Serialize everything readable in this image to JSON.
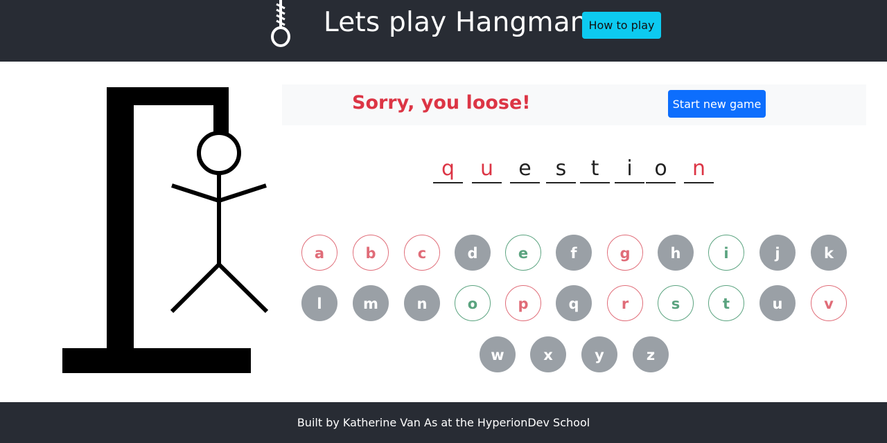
{
  "header": {
    "title": "Lets play Hangman",
    "how_to_play": "How to play"
  },
  "status": {
    "message": "Sorry, you loose!",
    "new_game": "Start new game"
  },
  "word": [
    {
      "letter": "q",
      "state": "missed"
    },
    {
      "letter": "u",
      "state": "missed"
    },
    {
      "letter": "e",
      "state": "found"
    },
    {
      "letter": "s",
      "state": "found"
    },
    {
      "letter": "t",
      "state": "found"
    },
    {
      "letter": "i",
      "state": "found"
    },
    {
      "letter": "o",
      "state": "found"
    },
    {
      "letter": "n",
      "state": "missed"
    }
  ],
  "keyboard": [
    {
      "letter": "a",
      "state": "wrong"
    },
    {
      "letter": "b",
      "state": "wrong"
    },
    {
      "letter": "c",
      "state": "wrong"
    },
    {
      "letter": "d",
      "state": "unused"
    },
    {
      "letter": "e",
      "state": "right"
    },
    {
      "letter": "f",
      "state": "unused"
    },
    {
      "letter": "g",
      "state": "wrong"
    },
    {
      "letter": "h",
      "state": "unused"
    },
    {
      "letter": "i",
      "state": "right"
    },
    {
      "letter": "j",
      "state": "unused"
    },
    {
      "letter": "k",
      "state": "unused"
    },
    {
      "letter": "l",
      "state": "unused"
    },
    {
      "letter": "m",
      "state": "unused"
    },
    {
      "letter": "n",
      "state": "unused"
    },
    {
      "letter": "o",
      "state": "right"
    },
    {
      "letter": "p",
      "state": "wrong"
    },
    {
      "letter": "q",
      "state": "unused"
    },
    {
      "letter": "r",
      "state": "wrong"
    },
    {
      "letter": "s",
      "state": "right"
    },
    {
      "letter": "t",
      "state": "right"
    },
    {
      "letter": "u",
      "state": "unused"
    },
    {
      "letter": "v",
      "state": "wrong"
    },
    {
      "letter": "w",
      "state": "unused"
    },
    {
      "letter": "x",
      "state": "unused"
    },
    {
      "letter": "y",
      "state": "unused"
    },
    {
      "letter": "z",
      "state": "unused"
    }
  ],
  "colors": {
    "header_bg": "#282c34",
    "info_button": "#0dcaf0",
    "primary_button": "#0d6efd",
    "loss_text": "#dc3545",
    "wrong_guess": "#e06c78",
    "right_guess": "#5aa37f",
    "unused_key": "#9aa0a6"
  },
  "footer": {
    "text": "Built by Katherine Van As at the HyperionDev School"
  }
}
